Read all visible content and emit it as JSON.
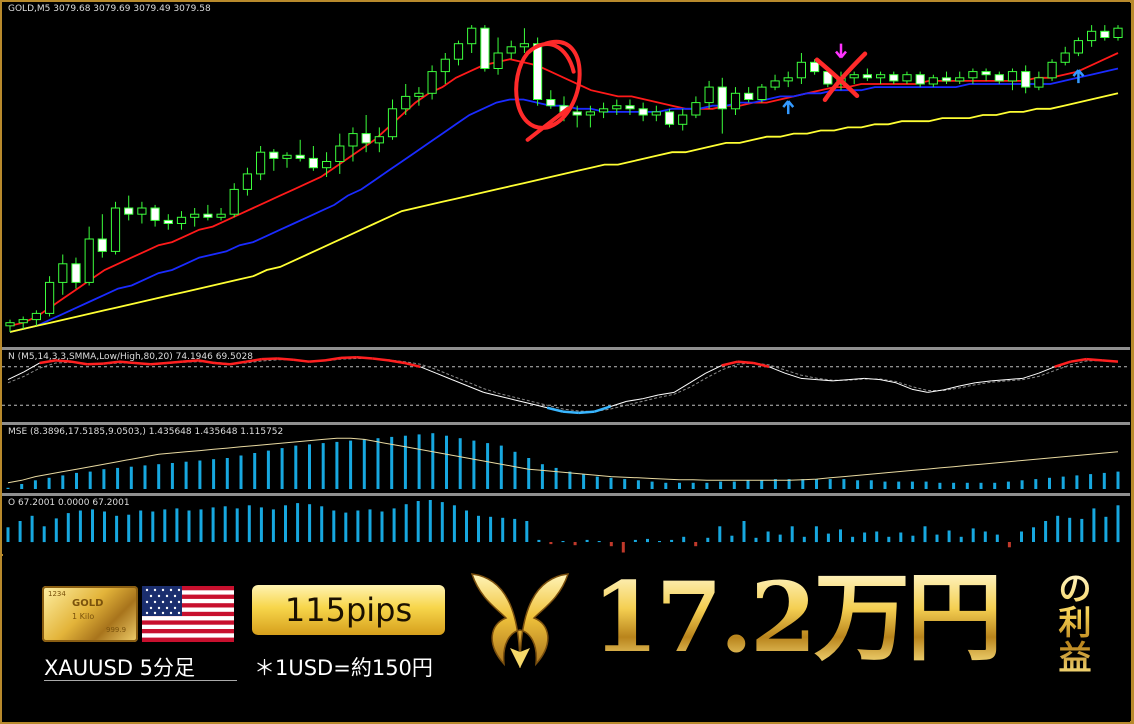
{
  "chart_data": [
    {
      "type": "candlestick",
      "title": "GOLD,M5  3079.68 3079.69 3079.49 3079.58",
      "symbol": "GOLD",
      "timeframe": "M5",
      "ohlc_readout": [
        3079.68,
        3079.69,
        3079.49,
        3079.58
      ],
      "ylim": [
        0,
        100
      ],
      "candles": [
        {
          "o": 2,
          "h": 4,
          "l": 0,
          "c": 3
        },
        {
          "o": 3,
          "h": 5,
          "l": 1,
          "c": 4
        },
        {
          "o": 4,
          "h": 7,
          "l": 2,
          "c": 6
        },
        {
          "o": 6,
          "h": 18,
          "l": 5,
          "c": 16
        },
        {
          "o": 16,
          "h": 25,
          "l": 12,
          "c": 22
        },
        {
          "o": 22,
          "h": 24,
          "l": 14,
          "c": 16
        },
        {
          "o": 16,
          "h": 34,
          "l": 15,
          "c": 30
        },
        {
          "o": 30,
          "h": 38,
          "l": 24,
          "c": 26
        },
        {
          "o": 26,
          "h": 42,
          "l": 25,
          "c": 40
        },
        {
          "o": 40,
          "h": 44,
          "l": 36,
          "c": 38
        },
        {
          "o": 38,
          "h": 42,
          "l": 35,
          "c": 40
        },
        {
          "o": 40,
          "h": 41,
          "l": 34,
          "c": 36
        },
        {
          "o": 36,
          "h": 38,
          "l": 33,
          "c": 35
        },
        {
          "o": 35,
          "h": 39,
          "l": 33,
          "c": 37
        },
        {
          "o": 37,
          "h": 40,
          "l": 34,
          "c": 38
        },
        {
          "o": 38,
          "h": 41,
          "l": 36,
          "c": 37
        },
        {
          "o": 37,
          "h": 40,
          "l": 36,
          "c": 38
        },
        {
          "o": 38,
          "h": 48,
          "l": 37,
          "c": 46
        },
        {
          "o": 46,
          "h": 53,
          "l": 44,
          "c": 51
        },
        {
          "o": 51,
          "h": 60,
          "l": 49,
          "c": 58
        },
        {
          "o": 58,
          "h": 59,
          "l": 52,
          "c": 56
        },
        {
          "o": 56,
          "h": 58,
          "l": 53,
          "c": 57
        },
        {
          "o": 57,
          "h": 62,
          "l": 55,
          "c": 56
        },
        {
          "o": 56,
          "h": 60,
          "l": 52,
          "c": 53
        },
        {
          "o": 53,
          "h": 58,
          "l": 50,
          "c": 55
        },
        {
          "o": 55,
          "h": 64,
          "l": 51,
          "c": 60
        },
        {
          "o": 60,
          "h": 66,
          "l": 55,
          "c": 64
        },
        {
          "o": 64,
          "h": 70,
          "l": 58,
          "c": 61
        },
        {
          "o": 61,
          "h": 66,
          "l": 58,
          "c": 63
        },
        {
          "o": 63,
          "h": 75,
          "l": 62,
          "c": 72
        },
        {
          "o": 72,
          "h": 80,
          "l": 70,
          "c": 76
        },
        {
          "o": 76,
          "h": 79,
          "l": 73,
          "c": 77
        },
        {
          "o": 77,
          "h": 86,
          "l": 75,
          "c": 84
        },
        {
          "o": 84,
          "h": 90,
          "l": 80,
          "c": 88
        },
        {
          "o": 88,
          "h": 94,
          "l": 86,
          "c": 93
        },
        {
          "o": 93,
          "h": 99,
          "l": 90,
          "c": 98
        },
        {
          "o": 98,
          "h": 99,
          "l": 84,
          "c": 85
        },
        {
          "o": 85,
          "h": 95,
          "l": 83,
          "c": 90
        },
        {
          "o": 90,
          "h": 94,
          "l": 88,
          "c": 92
        },
        {
          "o": 92,
          "h": 98,
          "l": 90,
          "c": 93
        },
        {
          "o": 93,
          "h": 95,
          "l": 73,
          "c": 75
        },
        {
          "o": 75,
          "h": 78,
          "l": 72,
          "c": 73
        },
        {
          "o": 73,
          "h": 76,
          "l": 68,
          "c": 71
        },
        {
          "o": 71,
          "h": 73,
          "l": 66,
          "c": 70
        },
        {
          "o": 70,
          "h": 73,
          "l": 66,
          "c": 71
        },
        {
          "o": 71,
          "h": 74,
          "l": 69,
          "c": 72
        },
        {
          "o": 72,
          "h": 75,
          "l": 70,
          "c": 73
        },
        {
          "o": 73,
          "h": 75,
          "l": 70,
          "c": 72
        },
        {
          "o": 72,
          "h": 74,
          "l": 68,
          "c": 70
        },
        {
          "o": 70,
          "h": 73,
          "l": 68,
          "c": 71
        },
        {
          "o": 71,
          "h": 72,
          "l": 66,
          "c": 67
        },
        {
          "o": 67,
          "h": 72,
          "l": 65,
          "c": 70
        },
        {
          "o": 70,
          "h": 76,
          "l": 69,
          "c": 74
        },
        {
          "o": 74,
          "h": 81,
          "l": 72,
          "c": 79
        },
        {
          "o": 79,
          "h": 82,
          "l": 64,
          "c": 72
        },
        {
          "o": 72,
          "h": 79,
          "l": 70,
          "c": 77
        },
        {
          "o": 77,
          "h": 79,
          "l": 74,
          "c": 75
        },
        {
          "o": 75,
          "h": 80,
          "l": 74,
          "c": 79
        },
        {
          "o": 79,
          "h": 83,
          "l": 78,
          "c": 81
        },
        {
          "o": 81,
          "h": 84,
          "l": 79,
          "c": 82
        },
        {
          "o": 82,
          "h": 90,
          "l": 80,
          "c": 87
        },
        {
          "o": 87,
          "h": 88,
          "l": 83,
          "c": 84
        },
        {
          "o": 84,
          "h": 85,
          "l": 79,
          "c": 80
        },
        {
          "o": 80,
          "h": 84,
          "l": 78,
          "c": 82
        },
        {
          "o": 82,
          "h": 84,
          "l": 80,
          "c": 83
        },
        {
          "o": 83,
          "h": 85,
          "l": 81,
          "c": 82
        },
        {
          "o": 82,
          "h": 84,
          "l": 80,
          "c": 83
        },
        {
          "o": 83,
          "h": 84,
          "l": 80,
          "c": 81
        },
        {
          "o": 81,
          "h": 84,
          "l": 80,
          "c": 83
        },
        {
          "o": 83,
          "h": 84,
          "l": 79,
          "c": 80
        },
        {
          "o": 80,
          "h": 83,
          "l": 79,
          "c": 82
        },
        {
          "o": 82,
          "h": 84,
          "l": 80,
          "c": 81
        },
        {
          "o": 81,
          "h": 84,
          "l": 80,
          "c": 82
        },
        {
          "o": 82,
          "h": 85,
          "l": 80,
          "c": 84
        },
        {
          "o": 84,
          "h": 85,
          "l": 81,
          "c": 83
        },
        {
          "o": 83,
          "h": 84,
          "l": 80,
          "c": 81
        },
        {
          "o": 81,
          "h": 85,
          "l": 78,
          "c": 84
        },
        {
          "o": 84,
          "h": 86,
          "l": 77,
          "c": 79
        },
        {
          "o": 79,
          "h": 84,
          "l": 78,
          "c": 82
        },
        {
          "o": 82,
          "h": 88,
          "l": 81,
          "c": 87
        },
        {
          "o": 87,
          "h": 92,
          "l": 86,
          "c": 90
        },
        {
          "o": 90,
          "h": 95,
          "l": 89,
          "c": 94
        },
        {
          "o": 94,
          "h": 99,
          "l": 92,
          "c": 97
        },
        {
          "o": 97,
          "h": 99,
          "l": 94,
          "c": 95
        },
        {
          "o": 95,
          "h": 99,
          "l": 94,
          "c": 98
        }
      ],
      "series": [
        {
          "name": "",
          "color": "#ff1a1a",
          "values": [
            2,
            3,
            5,
            8,
            11,
            14,
            17,
            20,
            22,
            24,
            26,
            28,
            29,
            31,
            33,
            34,
            36,
            38,
            40,
            42,
            44,
            46,
            48,
            50,
            53,
            56,
            59,
            62,
            66,
            70,
            74,
            77,
            79,
            82,
            84,
            86,
            87,
            88,
            87,
            86,
            84,
            82,
            80,
            78,
            77,
            76,
            76,
            75,
            74,
            73,
            72,
            72,
            72,
            73,
            73,
            74,
            74,
            75,
            76,
            77,
            78,
            79,
            79,
            80,
            80,
            80,
            80,
            80,
            81,
            81,
            81,
            81,
            81,
            81,
            81,
            81,
            82,
            82,
            83,
            84,
            86,
            88,
            90
          ]
        },
        {
          "name": "",
          "color": "#1a2bff",
          "values": [
            0,
            1,
            2,
            4,
            6,
            8,
            10,
            12,
            14,
            15,
            17,
            19,
            20,
            22,
            24,
            25,
            26,
            28,
            29,
            31,
            33,
            35,
            37,
            39,
            41,
            44,
            46,
            49,
            52,
            55,
            58,
            61,
            64,
            67,
            70,
            72,
            74,
            75,
            75,
            74,
            73,
            73,
            72,
            72,
            71,
            71,
            71,
            71,
            71,
            72,
            72,
            72,
            73,
            73,
            74,
            74,
            75,
            76,
            76,
            77,
            77,
            78,
            78,
            78,
            79,
            79,
            79,
            79,
            79,
            79,
            79,
            80,
            80,
            80,
            80,
            80,
            80,
            80,
            81,
            82,
            83,
            84,
            85
          ]
        },
        {
          "name": "",
          "color": "#ffff33",
          "values": [
            0,
            1,
            2,
            3,
            4,
            5,
            6,
            7,
            8,
            9,
            10,
            11,
            12,
            13,
            14,
            15,
            16,
            17,
            18,
            20,
            21,
            23,
            25,
            27,
            29,
            31,
            33,
            35,
            37,
            39,
            40,
            41,
            42,
            43,
            44,
            45,
            46,
            47,
            48,
            49,
            50,
            51,
            52,
            53,
            54,
            54,
            55,
            56,
            57,
            58,
            58,
            59,
            60,
            61,
            61,
            62,
            63,
            63,
            64,
            64,
            65,
            65,
            66,
            66,
            67,
            67,
            68,
            68,
            68,
            69,
            69,
            69,
            70,
            70,
            71,
            71,
            72,
            72,
            73,
            74,
            75,
            76,
            77
          ]
        }
      ],
      "signals": [
        {
          "type": "sell-arrow",
          "color": "#ff33ff",
          "at": 63
        },
        {
          "type": "buy-arrow",
          "color": "#3399ff",
          "at": 59
        },
        {
          "type": "buy-arrow",
          "color": "#3399ff",
          "at": 81
        }
      ]
    },
    {
      "type": "line",
      "title": "N (M5,14,3,3,SMMA,Low/High,80,20) 74.1946 69.5028",
      "ylim": [
        0,
        100
      ],
      "levels": [
        80,
        20
      ],
      "series": [
        {
          "name": "",
          "color": "#ffffff",
          "values": [
            60,
            72,
            86,
            90,
            88,
            84,
            85,
            88,
            86,
            84,
            86,
            88,
            90,
            86,
            84,
            88,
            92,
            93,
            91,
            88,
            90,
            94,
            95,
            93,
            90,
            86,
            80,
            70,
            60,
            50,
            40,
            34,
            28,
            22,
            16,
            10,
            8,
            10,
            18,
            26,
            30,
            36,
            40,
            55,
            70,
            82,
            88,
            86,
            80,
            70,
            62,
            60,
            58,
            60,
            62,
            60,
            55,
            45,
            40,
            44,
            50,
            55,
            58,
            60,
            62,
            70,
            80,
            88,
            92,
            90,
            88
          ]
        },
        {
          "name": "",
          "color": "#aaaaaa",
          "values": [
            55,
            65,
            78,
            86,
            87,
            85,
            84,
            86,
            86,
            85,
            85,
            87,
            88,
            87,
            85,
            86,
            89,
            91,
            91,
            89,
            89,
            92,
            93,
            93,
            91,
            88,
            84,
            76,
            66,
            56,
            46,
            38,
            32,
            26,
            20,
            14,
            11,
            10,
            14,
            20,
            26,
            32,
            37,
            48,
            62,
            75,
            84,
            86,
            83,
            75,
            67,
            62,
            59,
            59,
            61,
            61,
            57,
            49,
            43,
            43,
            47,
            52,
            56,
            58,
            60,
            65,
            74,
            83,
            89,
            90,
            89
          ]
        }
      ]
    },
    {
      "type": "bar",
      "title": "MSE (8.3896,17.5185,9.0503,) 1.435648 1.435648 1.115752",
      "values": [
        2,
        8,
        14,
        18,
        22,
        26,
        28,
        32,
        34,
        36,
        38,
        40,
        42,
        44,
        46,
        48,
        50,
        54,
        58,
        62,
        66,
        70,
        72,
        74,
        76,
        78,
        80,
        82,
        84,
        86,
        88,
        90,
        86,
        82,
        78,
        74,
        70,
        60,
        50,
        40,
        34,
        28,
        24,
        20,
        18,
        16,
        14,
        12,
        10,
        10,
        10,
        10,
        12,
        12,
        14,
        14,
        16,
        16,
        16,
        16,
        16,
        16,
        14,
        14,
        12,
        12,
        12,
        12,
        10,
        10,
        10,
        10,
        10,
        12,
        14,
        16,
        18,
        20,
        22,
        24,
        26,
        28
      ],
      "signal_line": [
        10,
        14,
        20,
        24,
        28,
        32,
        36,
        40,
        44,
        48,
        52,
        56,
        58,
        60,
        62,
        64,
        66,
        68,
        70,
        72,
        74,
        76,
        78,
        80,
        82,
        82,
        80,
        76,
        72,
        68,
        64,
        60,
        56,
        52,
        48,
        44,
        40,
        36,
        32,
        30,
        28,
        26,
        24,
        22,
        20,
        19,
        18,
        17,
        16,
        15,
        15,
        14,
        14,
        14,
        14,
        14,
        14,
        14,
        15,
        16,
        18,
        20,
        22,
        24,
        26,
        28,
        30,
        32,
        34,
        36,
        38,
        40,
        42,
        44,
        46,
        48,
        50,
        52,
        54,
        56,
        58,
        60
      ],
      "colors": {
        "bar": "#17a8e0",
        "line": "#e8d9a0"
      }
    },
    {
      "type": "bar",
      "title": "O 67.2001 0.0000 67.2001",
      "values": [
        28,
        40,
        50,
        30,
        45,
        55,
        60,
        62,
        58,
        50,
        52,
        60,
        58,
        62,
        64,
        60,
        62,
        66,
        68,
        64,
        70,
        66,
        62,
        70,
        74,
        72,
        68,
        60,
        56,
        60,
        62,
        58,
        64,
        72,
        78,
        80,
        76,
        70,
        60,
        50,
        48,
        46,
        44,
        40,
        4,
        -4,
        2,
        -6,
        4,
        2,
        -8,
        -20,
        4,
        6,
        2,
        4,
        10,
        -8,
        8,
        30,
        12,
        40,
        8,
        20,
        14,
        30,
        10,
        30,
        16,
        24,
        10,
        18,
        20,
        10,
        18,
        12,
        30,
        14,
        22,
        10,
        26,
        20,
        14,
        -10,
        20,
        28,
        40,
        50,
        46,
        44,
        64,
        48,
        70
      ],
      "colors": {
        "positive": "#17a8e0",
        "negative": "#c0392b"
      }
    }
  ],
  "banner": {
    "pair_label": "XAUUSD 5分足",
    "pips_label": "115pips",
    "rate_note": "＊1USD=約150円",
    "profit_amount": "17.2万円",
    "profit_suffix_1": "の",
    "profit_suffix_2": "利",
    "profit_suffix_3": "益",
    "gold_bar_text": [
      "1234",
      "GOLD",
      "1 Kilo",
      "999.9"
    ],
    "colors": {
      "gold": "#f2c94c",
      "frame": "#b88a2c"
    }
  }
}
